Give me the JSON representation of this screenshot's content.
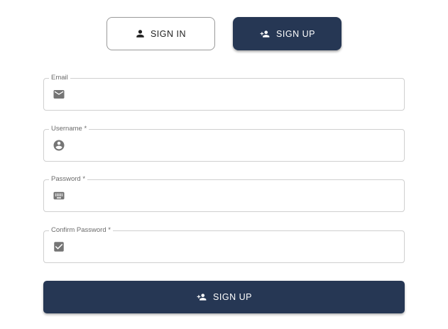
{
  "tabs": {
    "signin": {
      "label": "SIGN IN",
      "icon": "person-icon"
    },
    "signup": {
      "label": "SIGN UP",
      "icon": "person-add-icon"
    }
  },
  "form": {
    "fields": [
      {
        "label": "Email",
        "icon": "mail-icon",
        "value": ""
      },
      {
        "label": "Username *",
        "icon": "account-circle-icon",
        "value": ""
      },
      {
        "label": "Password *",
        "icon": "keyboard-icon",
        "value": ""
      },
      {
        "label": "Confirm Password *",
        "icon": "checkbox-icon",
        "value": ""
      }
    ],
    "submit": {
      "label": "SIGN UP",
      "icon": "person-add-icon"
    }
  },
  "colors": {
    "primary": "#263754",
    "icon_gray": "#757575",
    "border": "#cfcfcf"
  }
}
